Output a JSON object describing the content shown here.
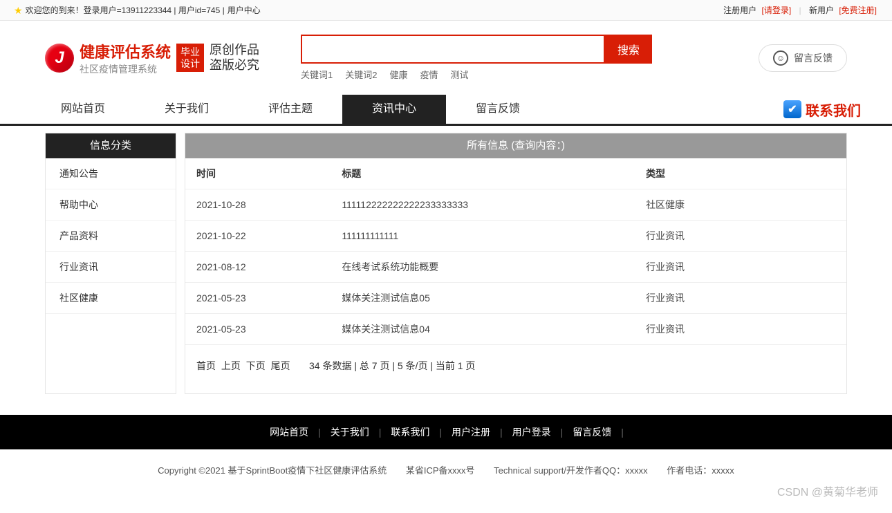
{
  "topbar": {
    "welcome": "欢迎您的到来！登录用户=13911223344 | 用户id=745 | ",
    "userCenter": "用户中心",
    "registered": "注册用户",
    "login": "[请登录]",
    "newUser": "新用户",
    "freeReg": "[免费注册]"
  },
  "logo": {
    "title": "健康评估系统",
    "subtitle": "社区疫情管理系统",
    "badge1": "毕业",
    "badge2": "设计",
    "script1": "原创作品",
    "script2": "盗版必究"
  },
  "search": {
    "button": "搜索",
    "keywords": [
      "关键词1",
      "关键词2",
      "健康",
      "疫情",
      "测试"
    ]
  },
  "feedback": {
    "label": "留言反馈"
  },
  "nav": {
    "items": [
      "网站首页",
      "关于我们",
      "评估主题",
      "资讯中心",
      "留言反馈"
    ],
    "activeIndex": 3,
    "contact": "联系我们"
  },
  "sidebar": {
    "header": "信息分类",
    "items": [
      "通知公告",
      "帮助中心",
      "产品资料",
      "行业资讯",
      "社区健康"
    ]
  },
  "content": {
    "header": "所有信息 (查询内容：)",
    "cols": [
      "时间",
      "标题",
      "类型"
    ],
    "rows": [
      {
        "date": "2021-10-28",
        "title": "111112222222222233333333",
        "type": "社区健康"
      },
      {
        "date": "2021-10-22",
        "title": "111111111111",
        "type": "行业资讯"
      },
      {
        "date": "2021-08-12",
        "title": "在线考试系统功能概要",
        "type": "行业资讯"
      },
      {
        "date": "2021-05-23",
        "title": "媒体关注测试信息05",
        "type": "行业资讯"
      },
      {
        "date": "2021-05-23",
        "title": "媒体关注测试信息04",
        "type": "行业资讯"
      }
    ],
    "pager": {
      "first": "首页",
      "prev": "上页",
      "next": "下页",
      "last": "尾页",
      "info": "34 条数据 | 总 7 页 | 5 条/页 | 当前 1 页"
    }
  },
  "footerNav": [
    "网站首页",
    "关于我们",
    "联系我们",
    "用户注册",
    "用户登录",
    "留言反馈"
  ],
  "footerInfo": {
    "copyright": "Copyright ©2021 基于SprintBoot疫情下社区健康评估系统",
    "icp": "某省ICP备xxxx号",
    "tech": "Technical support/开发作者QQ：xxxxx",
    "phone": "作者电话：xxxxx"
  },
  "watermark": "CSDN @黄菊华老师"
}
